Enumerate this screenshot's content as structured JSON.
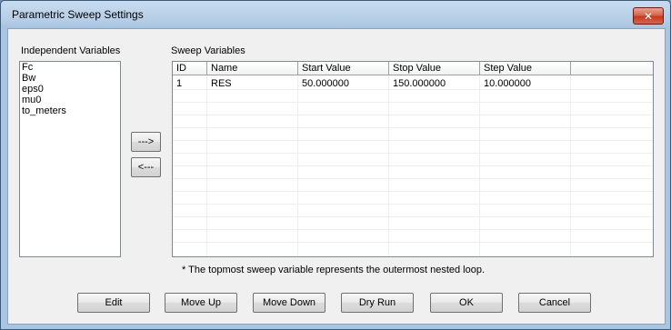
{
  "window": {
    "title": "Parametric Sweep Settings",
    "close_glyph": "✕"
  },
  "independent": {
    "label": "Independent Variables",
    "items": [
      "Fc",
      "Bw",
      "eps0",
      "mu0",
      "to_meters"
    ]
  },
  "move_right_label": "--->",
  "move_left_label": "<---",
  "sweep": {
    "label": "Sweep Variables",
    "columns": [
      "ID",
      "Name",
      "Start Value",
      "Stop Value",
      "Step Value"
    ],
    "rows": [
      [
        "1",
        "RES",
        "50.000000",
        "150.000000",
        "10.000000"
      ]
    ]
  },
  "note": "* The topmost sweep variable represents the outermost nested loop.",
  "buttons": {
    "edit": "Edit",
    "move_up": "Move Up",
    "move_down": "Move Down",
    "dry_run": "Dry Run",
    "ok": "OK",
    "cancel": "Cancel"
  }
}
